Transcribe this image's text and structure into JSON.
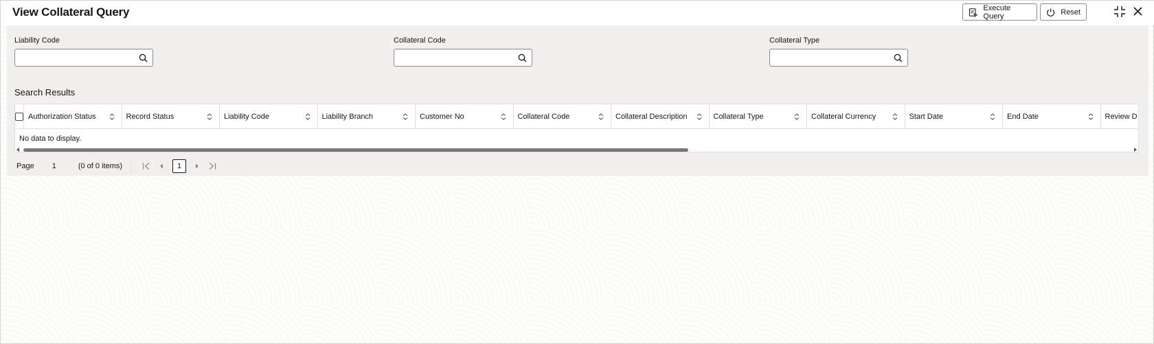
{
  "header": {
    "title": "View Collateral Query",
    "execute_label": "Execute Query",
    "reset_label": "Reset"
  },
  "filters": {
    "liability_code": {
      "label": "Liability Code",
      "value": "",
      "placeholder": ""
    },
    "collateral_code": {
      "label": "Collateral Code",
      "value": "",
      "placeholder": ""
    },
    "collateral_type": {
      "label": "Collateral Type",
      "value": "",
      "placeholder": ""
    }
  },
  "results": {
    "title": "Search Results",
    "columns": [
      "Authorization Status",
      "Record Status",
      "Liability Code",
      "Liability Branch",
      "Customer No",
      "Collateral Code",
      "Collateral Description",
      "Collateral Type",
      "Collateral Currency",
      "Start Date",
      "End Date",
      "Review D"
    ],
    "empty_text": "No data to display."
  },
  "pagination": {
    "page_label": "Page",
    "page_number": "1",
    "items_text": "(0 of 0 items)",
    "current_page": "1"
  },
  "colors": {
    "panel_bg": "#f1f0ee",
    "border": "#8c8a87",
    "text": "#161513"
  },
  "icons": [
    "execute-query-icon",
    "reset-icon",
    "collapse-icon",
    "close-icon",
    "search-icon",
    "sort-icon",
    "first-page-icon",
    "prev-page-icon",
    "next-page-icon",
    "last-page-icon"
  ]
}
